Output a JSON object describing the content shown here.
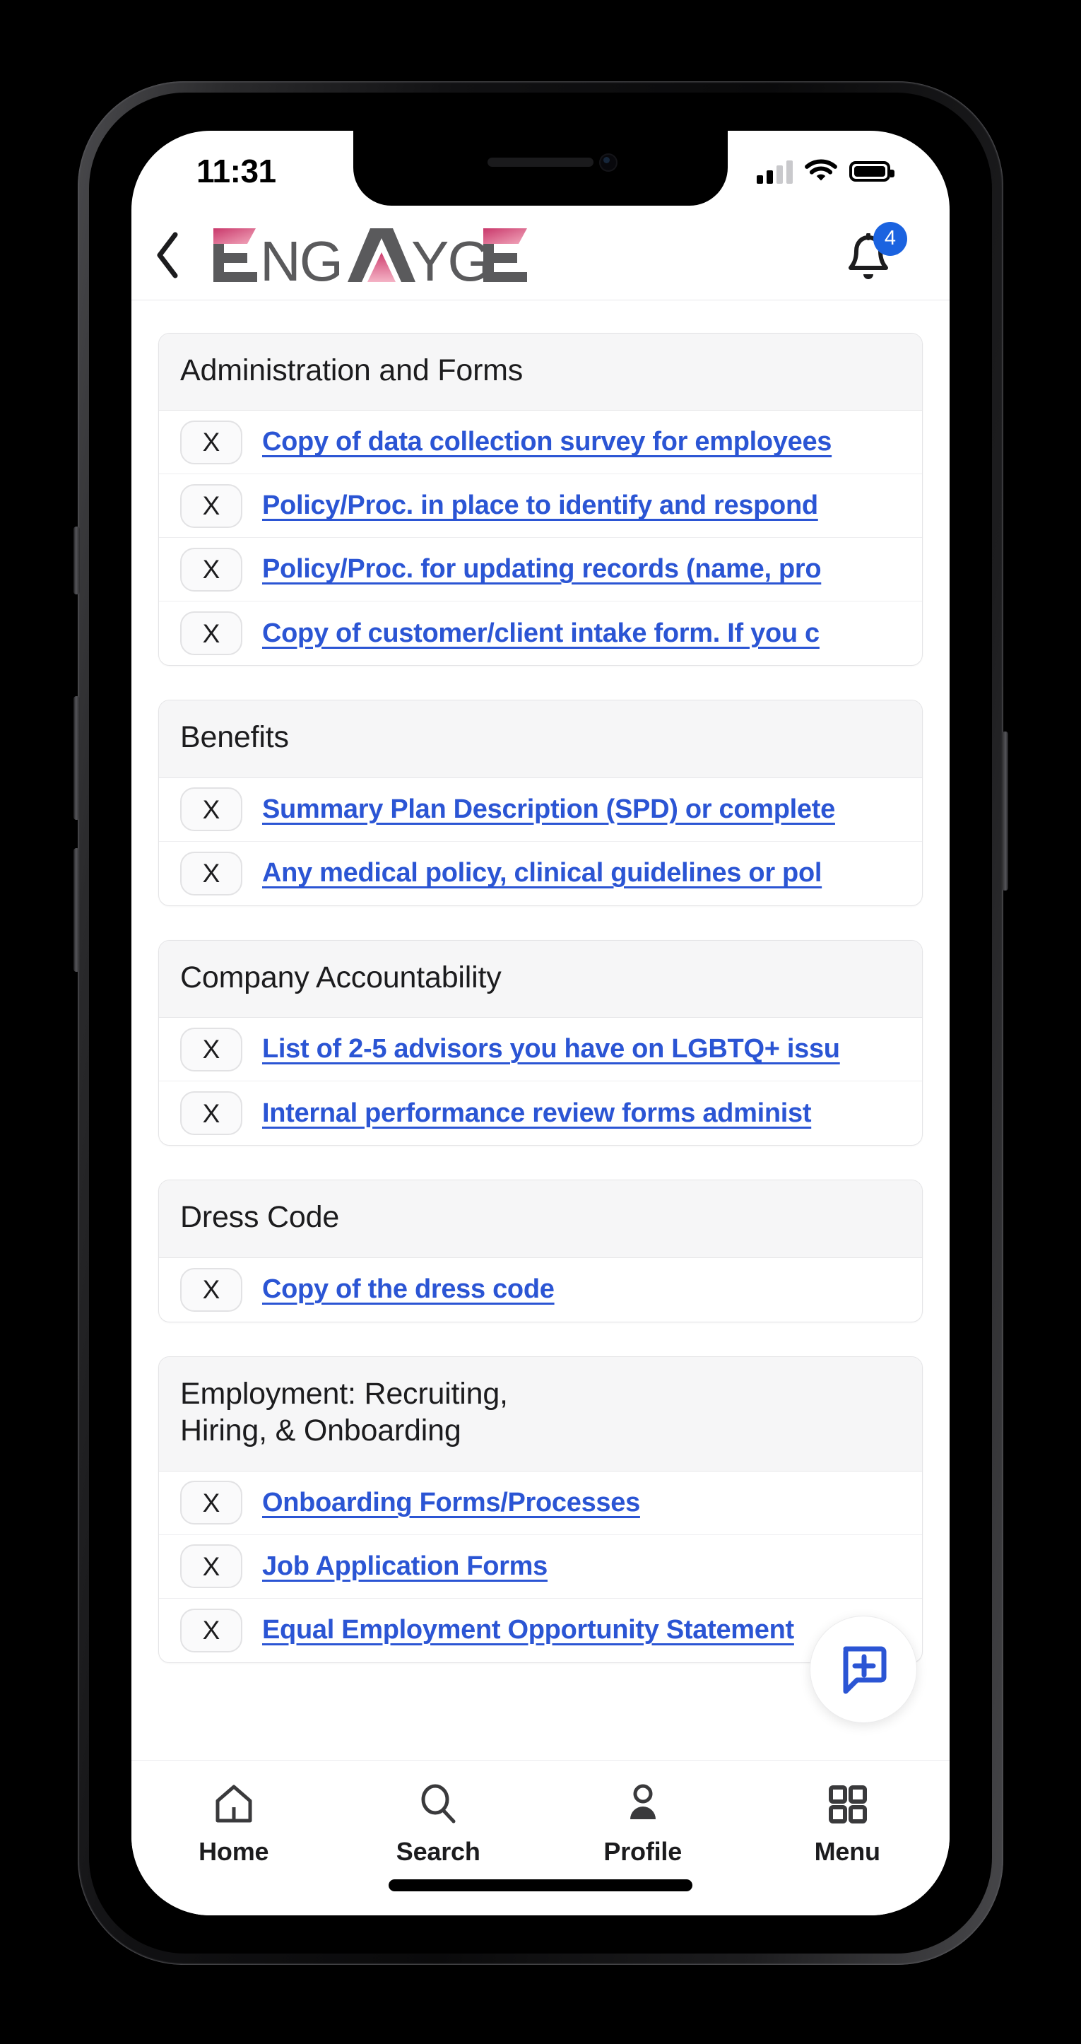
{
  "status_bar": {
    "time": "11:31",
    "signal_icon": "cellular-signal-icon",
    "wifi_icon": "wifi-icon",
    "battery_icon": "battery-icon"
  },
  "header": {
    "back_icon": "chevron-left-icon",
    "logo_text": "ENGAYGE",
    "logo_accent_color": "#d94f7a",
    "logo_text_color": "#5a5a5c",
    "bell_icon": "bell-icon",
    "notification_count": "4",
    "badge_color": "#1b63e0"
  },
  "link_color": "#2b55d4",
  "remove_label": "X",
  "sections": [
    {
      "title": "Administration and Forms",
      "items": [
        "Copy of data collection survey for employees",
        "Policy/Proc. in place to identify and respond",
        "Policy/Proc. for updating records (name, pro",
        "Copy of customer/client intake form. If you c"
      ]
    },
    {
      "title": "Benefits",
      "items": [
        "Summary Plan Description (SPD) or complete",
        "Any medical policy, clinical guidelines or pol"
      ]
    },
    {
      "title": "Company Accountability",
      "items": [
        "List of 2-5 advisors you have on LGBTQ+ issu",
        "Internal performance review forms administ"
      ]
    },
    {
      "title": "Dress Code",
      "items": [
        "Copy of the dress code"
      ]
    },
    {
      "title": "Employment: Recruiting,\nHiring, & Onboarding",
      "items": [
        "Onboarding Forms/Processes",
        "Job Application Forms",
        "Equal Employment Opportunity Statement"
      ]
    }
  ],
  "fab": {
    "icon": "chat-plus-icon",
    "color": "#2b55d4"
  },
  "bottom_nav": [
    {
      "label": "Home",
      "icon": "home-icon"
    },
    {
      "label": "Search",
      "icon": "search-icon"
    },
    {
      "label": "Profile",
      "icon": "person-icon"
    },
    {
      "label": "Menu",
      "icon": "grid-menu-icon"
    }
  ]
}
